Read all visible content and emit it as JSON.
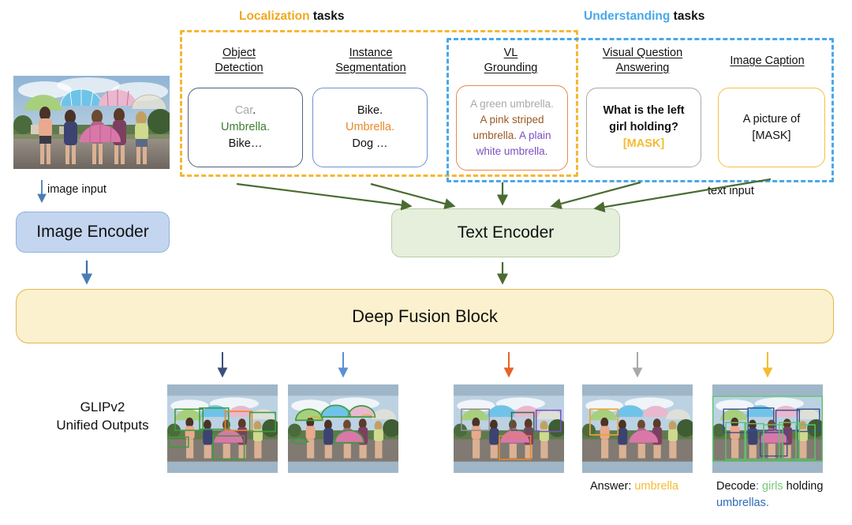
{
  "figure": {
    "title": "GLIPv2 unified architecture overview"
  },
  "groups": {
    "localization": {
      "accent_word": "Localization",
      "rest": " tasks",
      "color": "#f5b731"
    },
    "understanding": {
      "accent_word": "Understanding",
      "rest": " tasks",
      "color": "#4aa8e8"
    }
  },
  "tasks": [
    {
      "heading_line1": "Object",
      "heading_line2": "Detection",
      "border_color": "#51607a",
      "lines": [
        [
          {
            "t": "Car",
            "c": "c-gray"
          },
          {
            "t": ".",
            "c": "c-black"
          }
        ],
        [
          {
            "t": "Umbrella",
            "c": "c-green"
          },
          {
            "t": ".",
            "c": "c-green"
          }
        ],
        [
          {
            "t": "Bike…",
            "c": "c-black"
          }
        ]
      ]
    },
    {
      "heading_line1": "Instance",
      "heading_line2": "Segmentation",
      "border_color": "#6f93cf",
      "lines": [
        [
          {
            "t": "Bike.",
            "c": "c-black"
          }
        ],
        [
          {
            "t": "Umbrella",
            "c": "c-orange"
          },
          {
            "t": ".",
            "c": "c-orange"
          }
        ],
        [
          {
            "t": "Dog …",
            "c": "c-black"
          }
        ]
      ]
    },
    {
      "heading_line1": "VL",
      "heading_line2": "Grounding",
      "border_color": "#e8894f",
      "lines": [
        [
          {
            "t": "A green umbrella.",
            "c": "c-gray"
          }
        ],
        [
          {
            "t": "A pink striped",
            "c": "c-brown"
          }
        ],
        [
          {
            "t": "umbrella.",
            "c": "c-brown"
          },
          {
            "t": " A plain",
            "c": "c-purple"
          }
        ],
        [
          {
            "t": "white umbrella.",
            "c": "c-purple"
          }
        ]
      ]
    },
    {
      "heading_line1": "Visual Question",
      "heading_line2": "Answering",
      "border_color": "#a8a8a8",
      "lines": [
        [
          {
            "t": "What is the left",
            "c": "c-black"
          }
        ],
        [
          {
            "t": "girl holding?",
            "c": "c-black"
          }
        ],
        [
          {
            "t": "[MASK]",
            "c": "c-yellow"
          }
        ]
      ]
    },
    {
      "heading_line1": "Image Caption",
      "heading_line2": "",
      "border_color": "#f5c242",
      "lines": [
        [
          {
            "t": "A picture of",
            "c": "c-black"
          }
        ],
        [
          {
            "t": "[MASK]",
            "c": "c-black"
          }
        ]
      ]
    }
  ],
  "modules": {
    "image_encoder": "Image Encoder",
    "text_encoder": "Text Encoder",
    "deep_fusion": "Deep Fusion Block"
  },
  "labels": {
    "image_input": "image input",
    "text_input": "text input",
    "glipv2_line1": "GLIPv2",
    "glipv2_line2": "Unified Outputs"
  },
  "output_captions": {
    "vqa": [
      {
        "t": "Answer: ",
        "c": "c-black"
      },
      {
        "t": "umbrella",
        "c": "c-yellow"
      }
    ],
    "caption": [
      {
        "t": "Decode",
        "c": "c-black"
      },
      {
        "t": ":",
        "c": "c-blue"
      },
      {
        "t": " girls",
        "c": "c-lgreen"
      },
      {
        "t": " holding",
        "c": "c-black"
      },
      {
        "t": "\numbrellas.",
        "c": "c-blue"
      }
    ],
    "caption_line1": "Decode: girls holding",
    "caption_line2": "umbrellas."
  },
  "arrow_colors": {
    "image_input": "#4a7db5",
    "text_flow": "#4a6b31",
    "out_detection": "#3b4f7a",
    "out_segmentation": "#5b8fd6",
    "out_grounding": "#e8622a",
    "out_vqa": "#a8a8a8",
    "out_caption": "#f5bb32"
  },
  "output_boxes": {
    "detection": [
      "green",
      "green",
      "orange",
      "green",
      "green",
      "green"
    ],
    "segmentation": [
      "green"
    ],
    "grounding": [
      "gray",
      "purple",
      "orange"
    ],
    "vqa": [
      "orange"
    ],
    "caption": [
      "blue",
      "green"
    ]
  },
  "source_image": {
    "description": "five women holding umbrellas on a suburban street"
  }
}
